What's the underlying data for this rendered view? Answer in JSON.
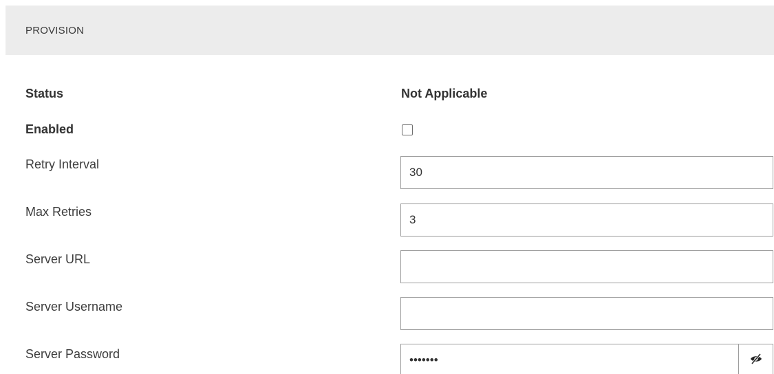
{
  "section": {
    "title": "PROVISION"
  },
  "fields": {
    "status": {
      "label": "Status",
      "value": "Not Applicable"
    },
    "enabled": {
      "label": "Enabled",
      "checked": false
    },
    "retry_interval": {
      "label": "Retry Interval",
      "value": "30"
    },
    "max_retries": {
      "label": "Max Retries",
      "value": "3"
    },
    "server_url": {
      "label": "Server URL",
      "value": ""
    },
    "server_username": {
      "label": "Server Username",
      "value": ""
    },
    "server_password": {
      "label": "Server Password",
      "value": "•••••••",
      "toggle_icon": "eye-slash-icon"
    }
  }
}
